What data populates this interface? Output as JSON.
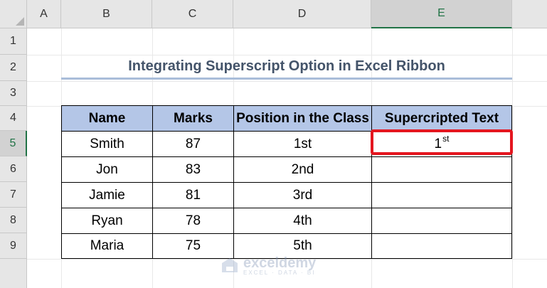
{
  "columns": [
    "A",
    "B",
    "C",
    "D",
    "E"
  ],
  "rows": [
    "1",
    "2",
    "3",
    "4",
    "5",
    "6",
    "7",
    "8",
    "9"
  ],
  "title": "Integrating Superscript Option in Excel Ribbon",
  "table": {
    "headers": [
      "Name",
      "Marks",
      "Position in the Class",
      "Supercripted Text"
    ],
    "data": [
      {
        "name": "Smith",
        "marks": "87",
        "position": "1st",
        "superscripted": {
          "base": "1",
          "sup": "st"
        }
      },
      {
        "name": "Jon",
        "marks": "83",
        "position": "2nd"
      },
      {
        "name": "Jamie",
        "marks": "81",
        "position": "3rd"
      },
      {
        "name": "Ryan",
        "marks": "78",
        "position": "4th"
      },
      {
        "name": "Maria",
        "marks": "75",
        "position": "5th"
      }
    ]
  },
  "watermark": {
    "name": "exceldemy",
    "tagline": "EXCEL · DATA · BI"
  },
  "colors": {
    "header_fill": "#b4c6e7",
    "highlight": "#e4161f",
    "title_text": "#44546a",
    "active_header": "#217346"
  }
}
